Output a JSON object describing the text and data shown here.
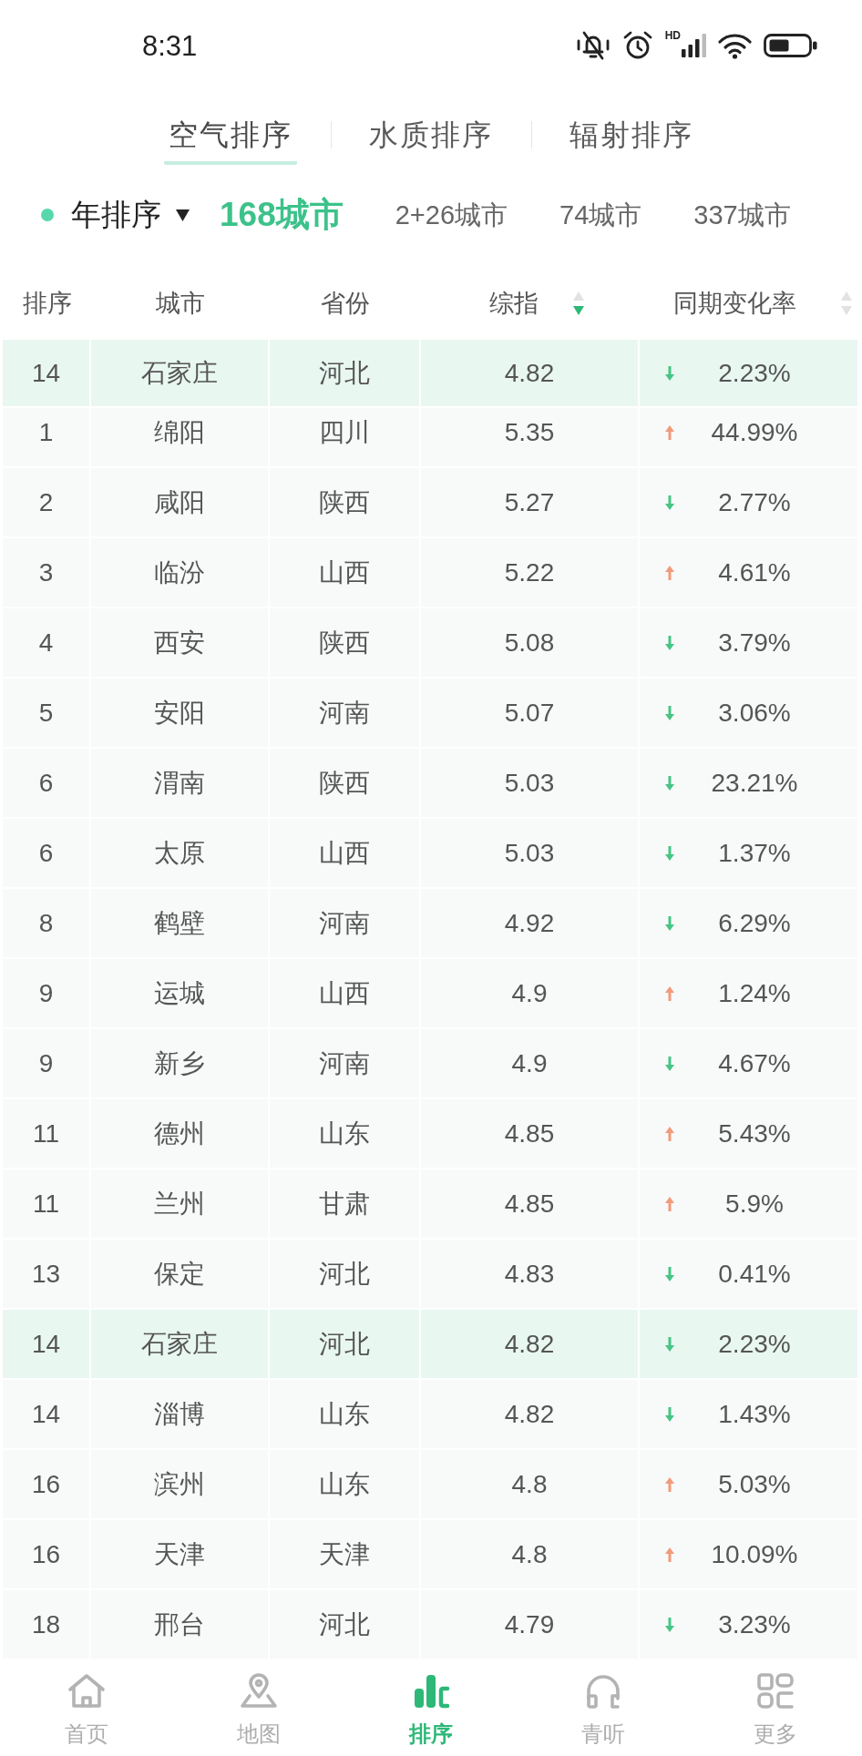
{
  "status_bar": {
    "time": "8:31",
    "network_label": "HD"
  },
  "tabs": [
    {
      "label": "空气排序",
      "selected": true
    },
    {
      "label": "水质排序",
      "selected": false
    },
    {
      "label": "辐射排序",
      "selected": false
    }
  ],
  "filter": {
    "period": "年排序",
    "city_groups": [
      {
        "label": "168城市",
        "selected": true
      },
      {
        "label": "2+26城市",
        "selected": false
      },
      {
        "label": "74城市",
        "selected": false
      },
      {
        "label": "337城市",
        "selected": false
      }
    ]
  },
  "table": {
    "columns": [
      {
        "label": "排序",
        "sortable": false,
        "sorted": false
      },
      {
        "label": "城市",
        "sortable": false,
        "sorted": false
      },
      {
        "label": "省份",
        "sortable": false,
        "sorted": false
      },
      {
        "label": "综指",
        "sortable": true,
        "sorted": true
      },
      {
        "label": "同期变化率",
        "sortable": true,
        "sorted": false
      }
    ],
    "pinned_row": {
      "rank": "14",
      "city": "石家庄",
      "province": "河北",
      "index": "4.82",
      "rising": false,
      "change": "2.23%",
      "highlighted": true
    },
    "rows": [
      {
        "rank": "1",
        "city": "绵阳",
        "province": "四川",
        "index": "5.35",
        "rising": true,
        "change": "44.99%",
        "highlighted": false
      },
      {
        "rank": "2",
        "city": "咸阳",
        "province": "陕西",
        "index": "5.27",
        "rising": false,
        "change": "2.77%",
        "highlighted": false
      },
      {
        "rank": "3",
        "city": "临汾",
        "province": "山西",
        "index": "5.22",
        "rising": true,
        "change": "4.61%",
        "highlighted": false
      },
      {
        "rank": "4",
        "city": "西安",
        "province": "陕西",
        "index": "5.08",
        "rising": false,
        "change": "3.79%",
        "highlighted": false
      },
      {
        "rank": "5",
        "city": "安阳",
        "province": "河南",
        "index": "5.07",
        "rising": false,
        "change": "3.06%",
        "highlighted": false
      },
      {
        "rank": "6",
        "city": "渭南",
        "province": "陕西",
        "index": "5.03",
        "rising": false,
        "change": "23.21%",
        "highlighted": false
      },
      {
        "rank": "6",
        "city": "太原",
        "province": "山西",
        "index": "5.03",
        "rising": false,
        "change": "1.37%",
        "highlighted": false
      },
      {
        "rank": "8",
        "city": "鹤壁",
        "province": "河南",
        "index": "4.92",
        "rising": false,
        "change": "6.29%",
        "highlighted": false
      },
      {
        "rank": "9",
        "city": "运城",
        "province": "山西",
        "index": "4.9",
        "rising": true,
        "change": "1.24%",
        "highlighted": false
      },
      {
        "rank": "9",
        "city": "新乡",
        "province": "河南",
        "index": "4.9",
        "rising": false,
        "change": "4.67%",
        "highlighted": false
      },
      {
        "rank": "11",
        "city": "德州",
        "province": "山东",
        "index": "4.85",
        "rising": true,
        "change": "5.43%",
        "highlighted": false
      },
      {
        "rank": "11",
        "city": "兰州",
        "province": "甘肃",
        "index": "4.85",
        "rising": true,
        "change": "5.9%",
        "highlighted": false
      },
      {
        "rank": "13",
        "city": "保定",
        "province": "河北",
        "index": "4.83",
        "rising": false,
        "change": "0.41%",
        "highlighted": false
      },
      {
        "rank": "14",
        "city": "石家庄",
        "province": "河北",
        "index": "4.82",
        "rising": false,
        "change": "2.23%",
        "highlighted": true
      },
      {
        "rank": "14",
        "city": "淄博",
        "province": "山东",
        "index": "4.82",
        "rising": false,
        "change": "1.43%",
        "highlighted": false
      },
      {
        "rank": "16",
        "city": "滨州",
        "province": "山东",
        "index": "4.8",
        "rising": true,
        "change": "5.03%",
        "highlighted": false
      },
      {
        "rank": "16",
        "city": "天津",
        "province": "天津",
        "index": "4.8",
        "rising": true,
        "change": "10.09%",
        "highlighted": false
      },
      {
        "rank": "18",
        "city": "邢台",
        "province": "河北",
        "index": "4.79",
        "rising": false,
        "change": "3.23%",
        "highlighted": false
      }
    ]
  },
  "bottom_nav": [
    {
      "label": "首页",
      "selected": false
    },
    {
      "label": "地图",
      "selected": false
    },
    {
      "label": "排序",
      "selected": true
    },
    {
      "label": "青听",
      "selected": false
    },
    {
      "label": "更多",
      "selected": false
    }
  ]
}
